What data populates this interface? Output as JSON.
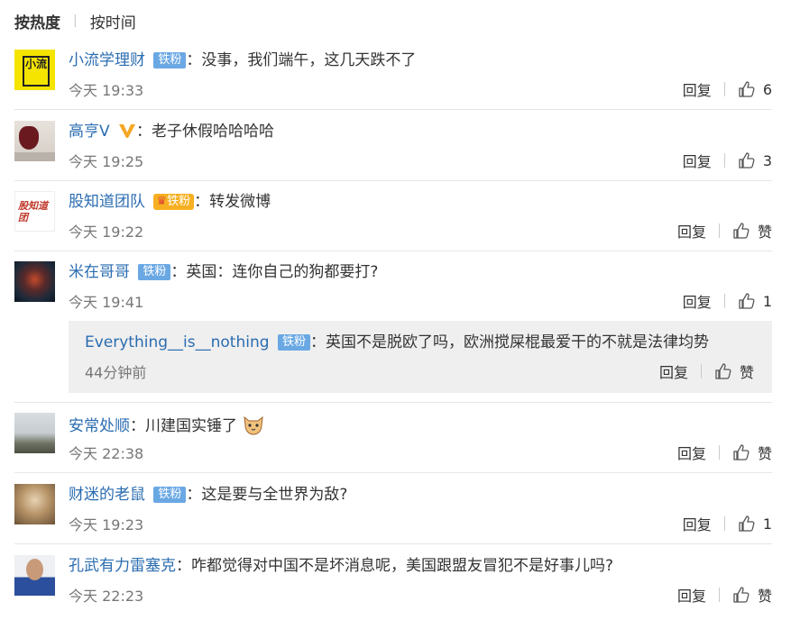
{
  "tabs": {
    "active": "按热度",
    "other": "按时间"
  },
  "labels": {
    "reply": "回复",
    "like": "赞"
  },
  "comments": [
    {
      "user": "小流学理财",
      "badge": "铁粉",
      "text": "：没事，我们端午，这几天跌不了",
      "time": "今天 19:33",
      "likes": "6",
      "avatar_text": "小流"
    },
    {
      "user": "高亨V",
      "text": "：老子休假哈哈哈哈",
      "time": "今天 19:25",
      "likes": "3"
    },
    {
      "user": "股知道团队",
      "badge": "铁粉",
      "text": "：转发微博",
      "time": "今天 19:22",
      "likes": "赞",
      "avatar_text": "股知道团"
    },
    {
      "user": "米在哥哥",
      "badge": "铁粉",
      "text": "：英国：连你自己的狗都要打?",
      "time": "今天 19:41",
      "likes": "1",
      "reply": {
        "user": "Everything__is__nothing",
        "badge": "铁粉",
        "text": "：英国不是脱欧了吗，欧洲搅屎棍最爱干的不就是法律均势",
        "time": "44分钟前",
        "likes": "赞"
      }
    },
    {
      "user": "安常处顺",
      "text": "：川建国实锤了",
      "time": "今天 22:38",
      "likes": "赞"
    },
    {
      "user": "财迷的老鼠",
      "badge": "铁粉",
      "text": "：这是要与全世界为敌?",
      "time": "今天 19:23",
      "likes": "1"
    },
    {
      "user": "孔武有力雷塞克",
      "text": "：咋都觉得对中国不是坏消息呢，美国跟盟友冒犯不是好事儿吗?",
      "time": "今天 22:23",
      "likes": "赞"
    }
  ],
  "colors": {
    "username": "#2a6cb0",
    "badge": "#6aa8e4",
    "meta": "#777777",
    "reply_bg": "#efefef"
  },
  "icons": [
    "thumbs-up-icon",
    "verified-v-icon",
    "cat-emoji-icon"
  ]
}
